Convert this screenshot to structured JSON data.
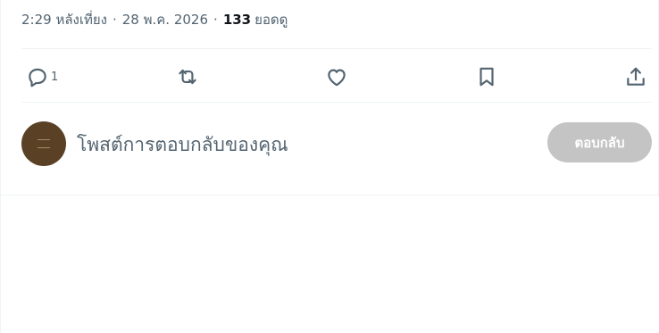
{
  "tweet_meta": {
    "time": "2:29 หลังเที่ยง",
    "separator": "·",
    "date": "28 พ.ค. 2026",
    "views_count": "133",
    "views_label": "ยอดดู"
  },
  "actions": {
    "reply_count": "1",
    "icons": [
      "reply-icon",
      "retweet-icon",
      "like-icon",
      "bookmark-icon",
      "share-icon"
    ]
  },
  "composer": {
    "placeholder": "โพสต์การตอบกลับของคุณ",
    "reply_button_label": "ตอบกลับ"
  },
  "colors": {
    "muted_text": "#536471",
    "divider": "#eff3f4",
    "disabled_button": "#c4c4c4",
    "avatar": "#5a4126"
  }
}
